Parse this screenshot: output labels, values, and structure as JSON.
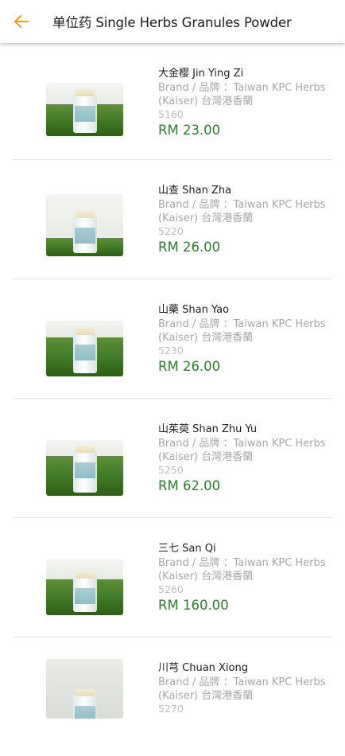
{
  "appbar": {
    "title": "单位药 Single Herbs Granules Powder",
    "back_icon": "arrow-left-icon",
    "accent_color": "#f39a1f"
  },
  "colors": {
    "price": "#2f7d2f",
    "brand_text": "#a7a7a7"
  },
  "products": [
    {
      "name": "大金樱 Jin Ying Zi",
      "brand": "Brand / 品牌 ：Taiwan KPC Herbs (Kaiser) 台灣港香蘭",
      "code": "5160",
      "price": "RM 23.00"
    },
    {
      "name": "山查 Shan Zha",
      "brand": "Brand / 品牌 ：Taiwan KPC Herbs (Kaiser) 台灣港香蘭",
      "code": "5220",
      "price": "RM 26.00"
    },
    {
      "name": "山藥 Shan Yao",
      "brand": "Brand / 品牌 ：Taiwan KPC Herbs (Kaiser) 台灣港香蘭",
      "code": "5230",
      "price": "RM 26.00"
    },
    {
      "name": "山茱萸 Shan Zhu Yu",
      "brand": "Brand / 品牌 ：Taiwan KPC Herbs (Kaiser) 台灣港香蘭",
      "code": "5250",
      "price": "RM 62.00"
    },
    {
      "name": "三七 San Qi",
      "brand": "Brand / 品牌 ：Taiwan KPC Herbs (Kaiser) 台灣港香蘭",
      "code": "5260",
      "price": "RM 160.00"
    },
    {
      "name": "川芎 Chuan Xiong",
      "brand": "Brand / 品牌 ：Taiwan KPC Herbs (Kaiser) 台灣港香蘭",
      "code": "5270",
      "price": ""
    }
  ]
}
